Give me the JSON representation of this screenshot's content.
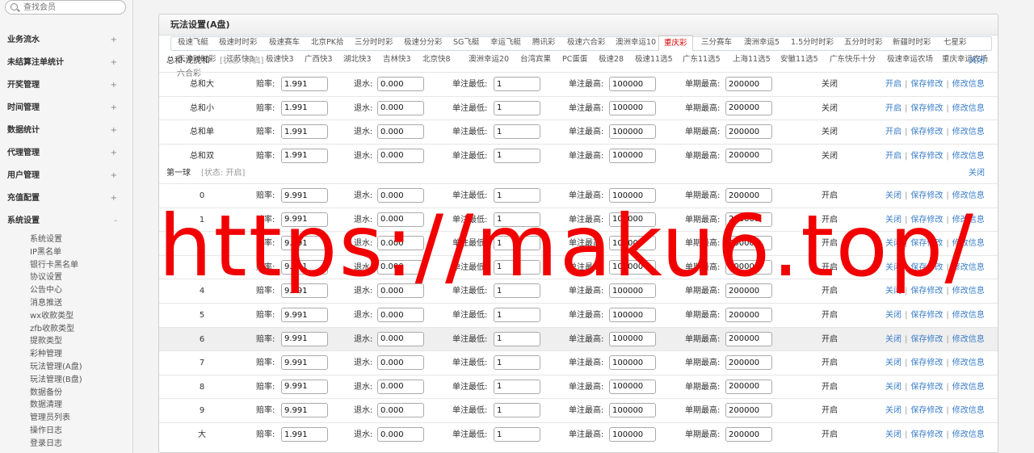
{
  "search": {
    "placeholder": "查找会员"
  },
  "sidebar": {
    "items": [
      {
        "label": "业务流水",
        "sign": "+"
      },
      {
        "label": "未结算注单统计",
        "sign": "+"
      },
      {
        "label": "开奖管理",
        "sign": "+"
      },
      {
        "label": "时间管理",
        "sign": "+"
      },
      {
        "label": "数据统计",
        "sign": "+"
      },
      {
        "label": "代理管理",
        "sign": "+"
      },
      {
        "label": "用户管理",
        "sign": "+"
      },
      {
        "label": "充值配置",
        "sign": "+"
      },
      {
        "label": "系统设置",
        "sign": "-"
      }
    ],
    "subitems": [
      "系统设置",
      "IP黑名单",
      "银行卡黑名单",
      "协议设置",
      "公告中心",
      "消息推送",
      "wx收款类型",
      "zfb收款类型",
      "提款类型",
      "彩种管理",
      "玩法管理(A盘)",
      "玩法管理(B盘)",
      "数据备份",
      "数据清理",
      "管理员列表",
      "操作日志",
      "登录日志"
    ]
  },
  "main": {
    "title": "玩法设置(A盘)",
    "tabs_row1": [
      "极速飞艇",
      "极速时时彩",
      "极速赛车",
      "北京PK拾",
      "三分时时彩",
      "极速分分彩",
      "SG飞艇",
      "幸运飞艇",
      "腾讯彩",
      "极速六合彩",
      "澳洲幸运10",
      "重庆彩",
      "三分赛车",
      "澳洲幸运5",
      "1.5分时时彩",
      "五分时时彩",
      "新疆时时彩",
      "七星彩"
    ],
    "active_tab": "重庆彩",
    "tabs_row2": [
      "天津时时彩",
      "江苏快3",
      "极速快3",
      "广西快3",
      "湖北快3",
      "吉林快3",
      "北京快8",
      "澳洲幸运20",
      "台湾宾果",
      "PC蛋蛋",
      "极速28",
      "极速11选5",
      "广东11选5",
      "上海11选5",
      "安徽11选5",
      "广东快乐十分",
      "极速幸运农场",
      "重庆幸运农场"
    ],
    "extra_tab": "六合彩"
  },
  "labels": {
    "odds": "赔率:",
    "rebate": "退水:",
    "min_bet": "单注最低:",
    "max_bet": "单注最高:",
    "max_period": "单期最高:",
    "close": "关闭",
    "open": "开启",
    "save": "保存修改",
    "edit": "修改信息"
  },
  "sections": [
    {
      "title": "总和-龙虎和",
      "status": "[状态: 开启]",
      "toggle": "关闭"
    },
    {
      "title": "第一球",
      "status": "[状态: 开启]",
      "toggle": "关闭"
    }
  ],
  "sum_rows": [
    {
      "name": "总和大",
      "odds": "1.991",
      "rebate": "0.000",
      "min": "1",
      "max": "100000",
      "period": "200000",
      "state": "关闭",
      "action": "开启"
    },
    {
      "name": "总和小",
      "odds": "1.991",
      "rebate": "0.000",
      "min": "1",
      "max": "100000",
      "period": "200000",
      "state": "关闭",
      "action": "开启"
    },
    {
      "name": "总和单",
      "odds": "1.991",
      "rebate": "0.000",
      "min": "1",
      "max": "100000",
      "period": "200000",
      "state": "关闭",
      "action": "开启"
    },
    {
      "name": "总和双",
      "odds": "1.991",
      "rebate": "0.000",
      "min": "1",
      "max": "100000",
      "period": "200000",
      "state": "关闭",
      "action": "开启"
    }
  ],
  "ball_rows": [
    {
      "name": "0",
      "odds": "9.991",
      "rebate": "0.000",
      "min": "1",
      "max": "100000",
      "period": "200000",
      "state": "开启",
      "action": "关闭"
    },
    {
      "name": "1",
      "odds": "9.991",
      "rebate": "0.000",
      "min": "1",
      "max": "100000",
      "period": "200000",
      "state": "开启",
      "action": "关闭"
    },
    {
      "name": "2",
      "odds": "9.991",
      "rebate": "0.000",
      "min": "1",
      "max": "100000",
      "period": "200000",
      "state": "开启",
      "action": "关闭"
    },
    {
      "name": "3",
      "odds": "9.991",
      "rebate": "0.000",
      "min": "1",
      "max": "100000",
      "period": "200000",
      "state": "开启",
      "action": "关闭"
    },
    {
      "name": "4",
      "odds": "9.991",
      "rebate": "0.000",
      "min": "1",
      "max": "100000",
      "period": "200000",
      "state": "开启",
      "action": "关闭"
    },
    {
      "name": "5",
      "odds": "9.991",
      "rebate": "0.000",
      "min": "1",
      "max": "100000",
      "period": "200000",
      "state": "开启",
      "action": "关闭"
    },
    {
      "name": "6",
      "odds": "9.991",
      "rebate": "0.000",
      "min": "1",
      "max": "100000",
      "period": "200000",
      "state": "开启",
      "action": "关闭"
    },
    {
      "name": "7",
      "odds": "9.991",
      "rebate": "0.000",
      "min": "1",
      "max": "100000",
      "period": "200000",
      "state": "开启",
      "action": "关闭"
    },
    {
      "name": "8",
      "odds": "9.991",
      "rebate": "0.000",
      "min": "1",
      "max": "100000",
      "period": "200000",
      "state": "开启",
      "action": "关闭"
    },
    {
      "name": "9",
      "odds": "9.991",
      "rebate": "0.000",
      "min": "1",
      "max": "100000",
      "period": "200000",
      "state": "开启",
      "action": "关闭"
    },
    {
      "name": "大",
      "odds": "1.991",
      "rebate": "0.000",
      "min": "1",
      "max": "100000",
      "period": "200000",
      "state": "开启",
      "action": "关闭"
    }
  ],
  "watermark": "https://maku6.top/",
  "colors": {
    "link": "#3a7dc9",
    "active_tab": "#dd0000",
    "watermark": "#f20000"
  }
}
